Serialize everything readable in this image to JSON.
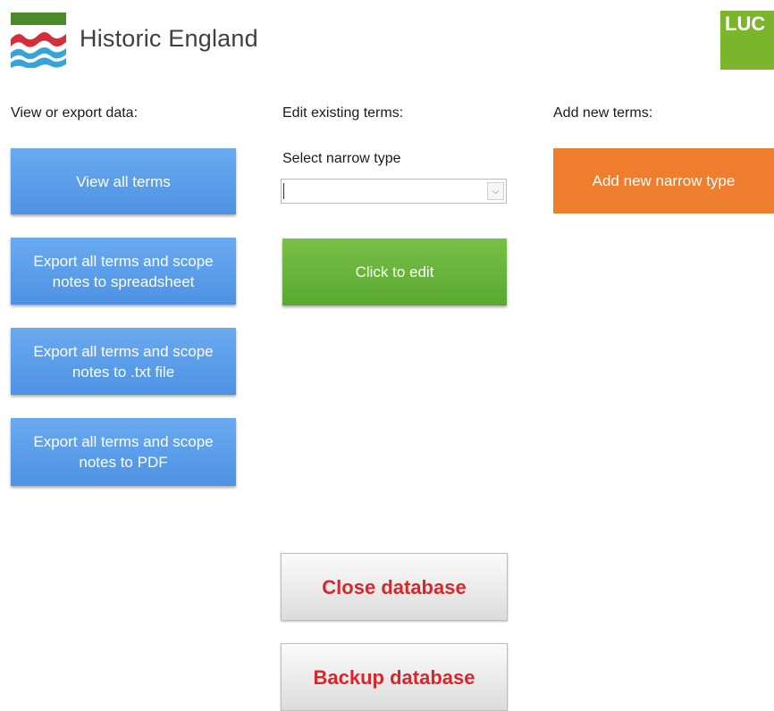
{
  "brand": {
    "name": "Historic England",
    "partner_logo": "LUC",
    "colors": {
      "logo_red": "#d32f3a",
      "logo_green": "#4a8a2a",
      "logo_blue": "#36a3d9",
      "partner_green": "#7ab52b"
    }
  },
  "view_export": {
    "heading": "View or export data:",
    "buttons": [
      "View all terms",
      "Export all terms and scope notes to spreadsheet",
      "Export all terms and scope notes to .txt file",
      "Export all terms and scope notes to PDF"
    ]
  },
  "edit": {
    "heading": "Edit existing terms:",
    "select_label": "Select narrow type",
    "select_value": "",
    "edit_button": "Click to edit"
  },
  "add": {
    "heading": "Add new terms:",
    "button": "Add new narrow type"
  },
  "database": {
    "close_button": "Close database",
    "backup_button": "Backup database"
  },
  "icons": {
    "select_caret": "chevron-down-icon"
  }
}
